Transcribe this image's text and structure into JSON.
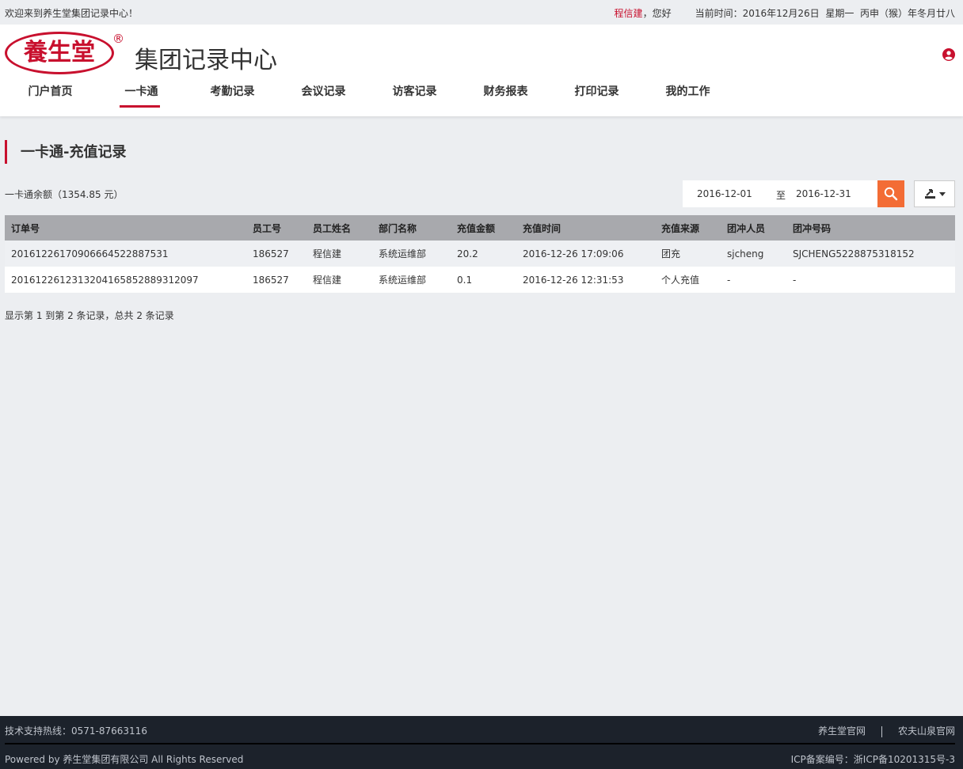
{
  "topbar": {
    "welcome": "欢迎来到养生堂集团记录中心！",
    "user": "程信建",
    "greeting": "，您好",
    "time_label": "当前时间：",
    "date": "2016年12月26日",
    "weekday": "星期一",
    "lunar": "丙申（猴）年冬月廿八"
  },
  "header": {
    "logo_text": "養生堂",
    "reg_mark": "®",
    "site_title": "集团记录中心"
  },
  "nav": {
    "items": [
      {
        "label": "门户首页"
      },
      {
        "label": "一卡通"
      },
      {
        "label": "考勤记录"
      },
      {
        "label": "会议记录"
      },
      {
        "label": "访客记录"
      },
      {
        "label": "财务报表"
      },
      {
        "label": "打印记录"
      },
      {
        "label": "我的工作"
      }
    ],
    "active": "一卡通"
  },
  "section": {
    "title": "一卡通-充值记录",
    "balance": "一卡通余额（1354.85 元）"
  },
  "filter": {
    "date_from": "2016-12-01",
    "separator": "至",
    "date_to": "2016-12-31",
    "search_icon": "search-icon",
    "export_icon": "export-icon"
  },
  "table": {
    "headers": [
      "订单号",
      "员工号",
      "员工姓名",
      "部门名称",
      "充值金额",
      "充值时间",
      "充值来源",
      "团冲人员",
      "团冲号码"
    ],
    "rows": [
      [
        "2016122617090666452288 7531",
        "186527",
        "程信建",
        "系统运维部",
        "20.2",
        "2016-12-26 17:09:06",
        "团充",
        "sjcheng",
        "SJCHENG5228875318152"
      ],
      [
        "20161226123132041658528893 12097",
        "186527",
        "程信建",
        "系统运维部",
        "0.1",
        "2016-12-26 12:31:53",
        "个人充值",
        "-",
        "-"
      ]
    ]
  },
  "paging": "显示第 1 到第 2 条记录，总共 2 条记录",
  "footer": {
    "hotline": "技术支持热线：0571-87663116",
    "link1": "养生堂官网",
    "link2": "农夫山泉官网",
    "powered": "Powered by 养生堂集团有限公司 All Rights Reserved",
    "icp": "ICP备案编号：浙ICP备10201315号-3"
  },
  "colors": {
    "accent": "#c8102e",
    "search_button": "#f36c35",
    "table_header": "#a8a9ad",
    "footer_bg": "#1c222b"
  }
}
